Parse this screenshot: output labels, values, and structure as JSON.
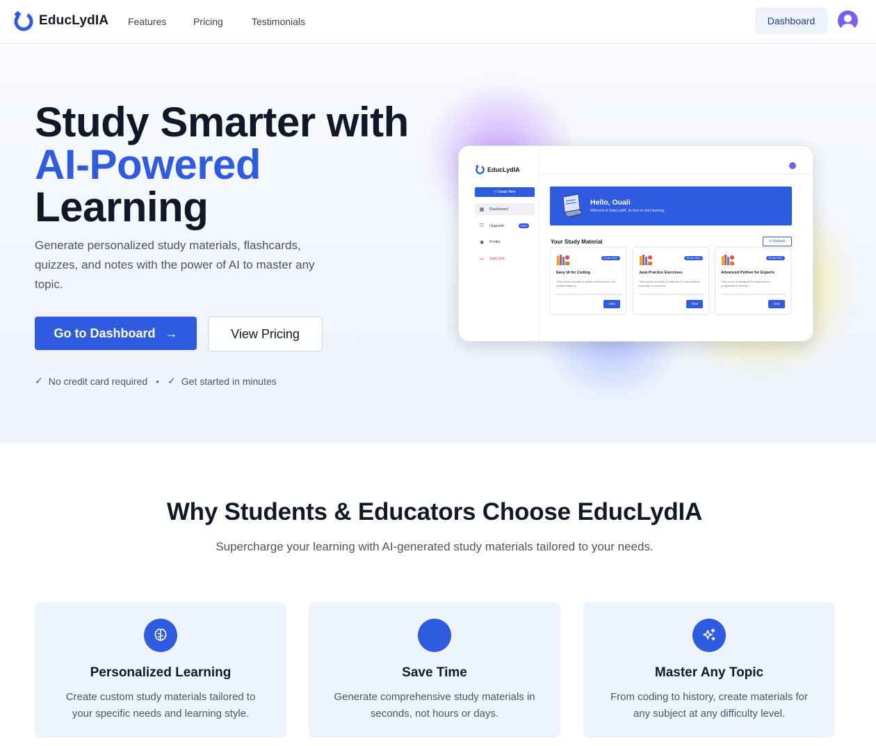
{
  "brand": {
    "name": "EducLydIA",
    "accent": "#2f5be0"
  },
  "nav": {
    "links": [
      "Features",
      "Pricing",
      "Testimonials"
    ],
    "dashboard_label": "Dashboard"
  },
  "hero": {
    "title_line1": "Study Smarter with",
    "title_accent": "AI-Powered",
    "title_line3": "Learning",
    "description": "Generate personalized study materials, flashcards, quizzes, and notes with the power of AI to master any topic.",
    "primary_cta": "Go to Dashboard",
    "primary_cta_icon": "→",
    "secondary_cta": "View Pricing",
    "perks": [
      "No credit card required",
      "Get started in minutes"
    ],
    "check_icon": "✓",
    "separator": "•"
  },
  "mock_app": {
    "brand": "EducLydIA",
    "create_label": "+ Create New",
    "menu": [
      {
        "label": "Dashboard",
        "icon": "grid-icon"
      },
      {
        "label": "Upgrade",
        "icon": "shield-icon",
        "badge": "PRO"
      },
      {
        "label": "Profile",
        "icon": "user-circle-icon"
      },
      {
        "label": "Sign Out",
        "icon": "logout-icon"
      }
    ],
    "greeting": "Hello, Ouali",
    "welcome": "Welcome to EducLydIA, Its time to start learning",
    "section_title": "Your Study Material",
    "refresh_label": "Refresh",
    "view_label": "View",
    "courses": [
      {
        "title": "Easy IA for Coding",
        "date": "20-dec 2024",
        "desc": "This course provides a gentle introduction to the fundamentals of..."
      },
      {
        "title": "Java Practice Exercises",
        "date": "20-dec 2024",
        "desc": "This course provides a collection of Java practice exercises to reinforce..."
      },
      {
        "title": "Advanced Python for Experts",
        "date": "20-dec 2024",
        "desc": "This course is designed for experienced programmers looking f..."
      }
    ]
  },
  "features": {
    "title": "Why Students & Educators Choose EducLydIA",
    "subtitle": "Supercharge your learning with AI-generated study materials tailored to your needs.",
    "cards": [
      {
        "title": "Personalized Learning",
        "desc": "Create custom study materials tailored to your specific needs and learning style.",
        "icon": "brain-icon"
      },
      {
        "title": "Save Time",
        "desc": "Generate comprehensive study materials in seconds, not hours or days.",
        "icon": "clock-icon"
      },
      {
        "title": "Master Any Topic",
        "desc": "From coding to history, create materials for any subject at any difficulty level.",
        "icon": "sparkles-icon"
      }
    ]
  }
}
